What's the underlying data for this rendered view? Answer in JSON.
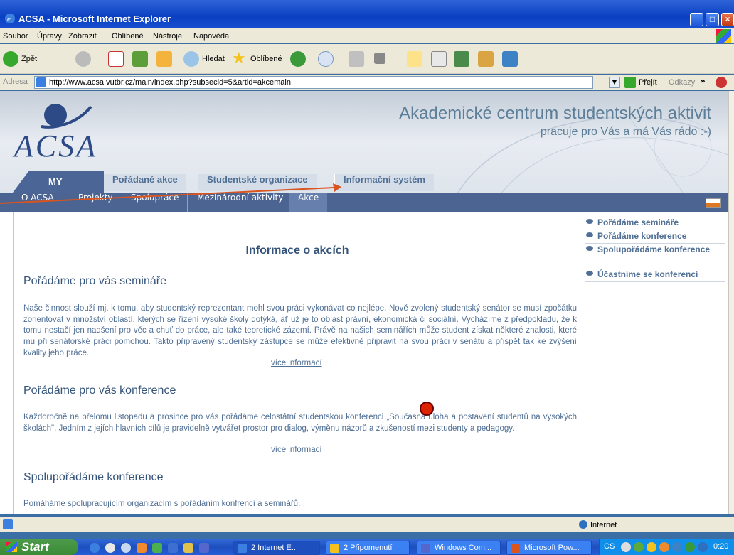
{
  "window": {
    "title": "ACSA - Microsoft Internet Explorer"
  },
  "menu": [
    "Soubor",
    "Úpravy",
    "Zobrazit",
    "Oblíbené",
    "Nástroje",
    "Nápověda"
  ],
  "toolbar": {
    "back": "Zpět",
    "search": "Hledat",
    "favorites": "Oblíbené"
  },
  "address": {
    "label": "Adresa",
    "url": "http://www.acsa.vutbr.cz/main/index.php?subsecid=5&artid=akcemain",
    "go": "Přejít",
    "links": "Odkazy"
  },
  "site": {
    "logo": "ACSA",
    "title": "Akademické centrum studentských aktivit",
    "subtitle": "pracuje pro Vás a má Vás rádo :-)"
  },
  "tabs": [
    "MY",
    "Pořádané akce",
    "Studentské organizace",
    "Informační systém"
  ],
  "nav": [
    "O ACSA",
    "Projekty",
    "Spolupráce",
    "Mezinárodní aktivity",
    "Akce"
  ],
  "main": {
    "heading": "Informace o akcích",
    "sections": [
      {
        "title": "Pořádáme pro vás semináře",
        "text": "Naše činnost slouží mj. k tomu, aby studentský reprezentant mohl svou práci vykonávat co nejlépe. Nově zvolený studentský senátor se musí zpočátku zorientovat v množství oblastí, kterých se řízení vysoké školy dotýká, ať už je to oblast právní, ekonomická či sociální. Vycházíme z předpokladu, že k tomu nestačí jen nadšení pro věc a chuť do práce, ale také teoretické zázemí. Právě na našich seminářích může student získat některé znalosti, které mu při senátorské práci pomohou. Takto připravený studentský zástupce se může efektivně připravit na svou práci v senátu a přispět tak ke zvýšení kvality jeho práce.",
        "link": "více informací"
      },
      {
        "title": "Pořádáme pro vás konference",
        "text": "Každoročně na přelomu listopadu a prosince pro vás pořádáme celostátní studentskou konferenci „Současná úloha a postavení studentů na vysokých školách\". Jedním z jejích hlavních cílů je pravidelně vytvářet prostor pro dialog, výměnu názorů a zkušeností mezi studenty a pedagogy.",
        "link": "více informací"
      },
      {
        "title": "Spolupořádáme konference",
        "text": "Pomáháme spolupracujícím organizacím s pořádáním konfrencí a seminářů."
      }
    ]
  },
  "sidebar": [
    "Pořádáme semináře",
    "Pořádáme konference",
    "Spolupořádáme konference",
    "Účastníme se konferencí"
  ],
  "status": {
    "zone": "Internet"
  },
  "taskbar": {
    "start": "Start",
    "buttons": [
      "2 Internet E...",
      "2 Připomenutí",
      "Windows Com...",
      "Microsoft Pow..."
    ],
    "lang": "CS",
    "clock": "0:20"
  }
}
